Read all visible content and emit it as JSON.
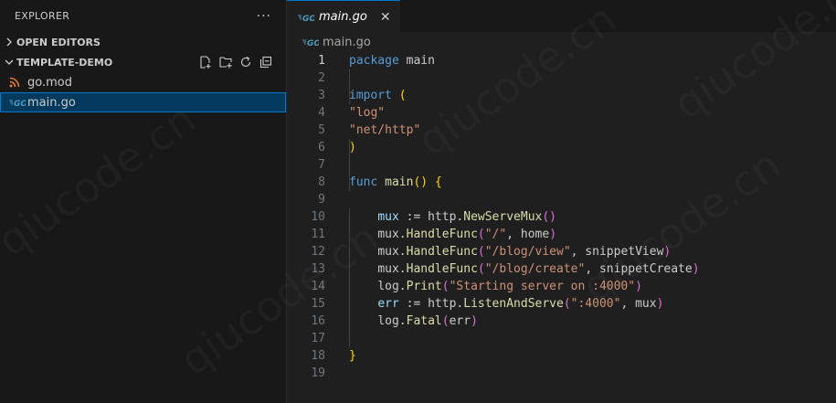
{
  "explorer": {
    "title": "EXPLORER",
    "more_label": "···",
    "sections": {
      "open_editors": "OPEN EDITORS",
      "project": "TEMPLATE-DEMO"
    },
    "files": [
      {
        "name": "go.mod",
        "icon": "rss-icon"
      },
      {
        "name": "main.go",
        "icon": "go-icon",
        "active": true
      }
    ]
  },
  "tabs": [
    {
      "label": "main.go",
      "icon": "go-icon",
      "close": "✕",
      "active": true
    }
  ],
  "breadcrumb": {
    "file": "main.go"
  },
  "code": {
    "line_numbers": [
      "1",
      "2",
      "3",
      "4",
      "5",
      "6",
      "7",
      "8",
      "9",
      "10",
      "11",
      "12",
      "13",
      "14",
      "15",
      "16",
      "17",
      "18",
      "19"
    ],
    "lines": {
      "l1": [
        "package",
        " main"
      ],
      "l3": [
        "import",
        " ",
        "("
      ],
      "l4": "\"log\"",
      "l5": "\"net/http\"",
      "l6": ")",
      "l8": [
        "func",
        " ",
        "main",
        "()",
        " ",
        "{"
      ],
      "l10": [
        "mux",
        " := http.",
        "NewServeMux",
        "()"
      ],
      "l11": [
        "mux.",
        "HandleFunc",
        "(",
        "\"/\"",
        ", home",
        ")"
      ],
      "l12": [
        "mux.",
        "HandleFunc",
        "(",
        "\"/blog/view\"",
        ", snippetView",
        ")"
      ],
      "l13": [
        "mux.",
        "HandleFunc",
        "(",
        "\"/blog/create\"",
        ", snippetCreate",
        ")"
      ],
      "l14": [
        "log.",
        "Print",
        "(",
        "\"Starting server on :4000\"",
        ")"
      ],
      "l15": [
        "err",
        " := http.",
        "ListenAndServe",
        "(",
        "\":4000\"",
        ", mux",
        ")"
      ],
      "l16": [
        "log.",
        "Fatal",
        "(",
        "err",
        ")"
      ],
      "l18": "}"
    }
  },
  "colors": {
    "keyword": "#569cd6",
    "string": "#ce9178",
    "function": "#dcdcaa",
    "variable": "#9cdcfe",
    "bracket": "#ffd700",
    "accent": "#0078d4"
  },
  "watermark": "qiucode.cn"
}
